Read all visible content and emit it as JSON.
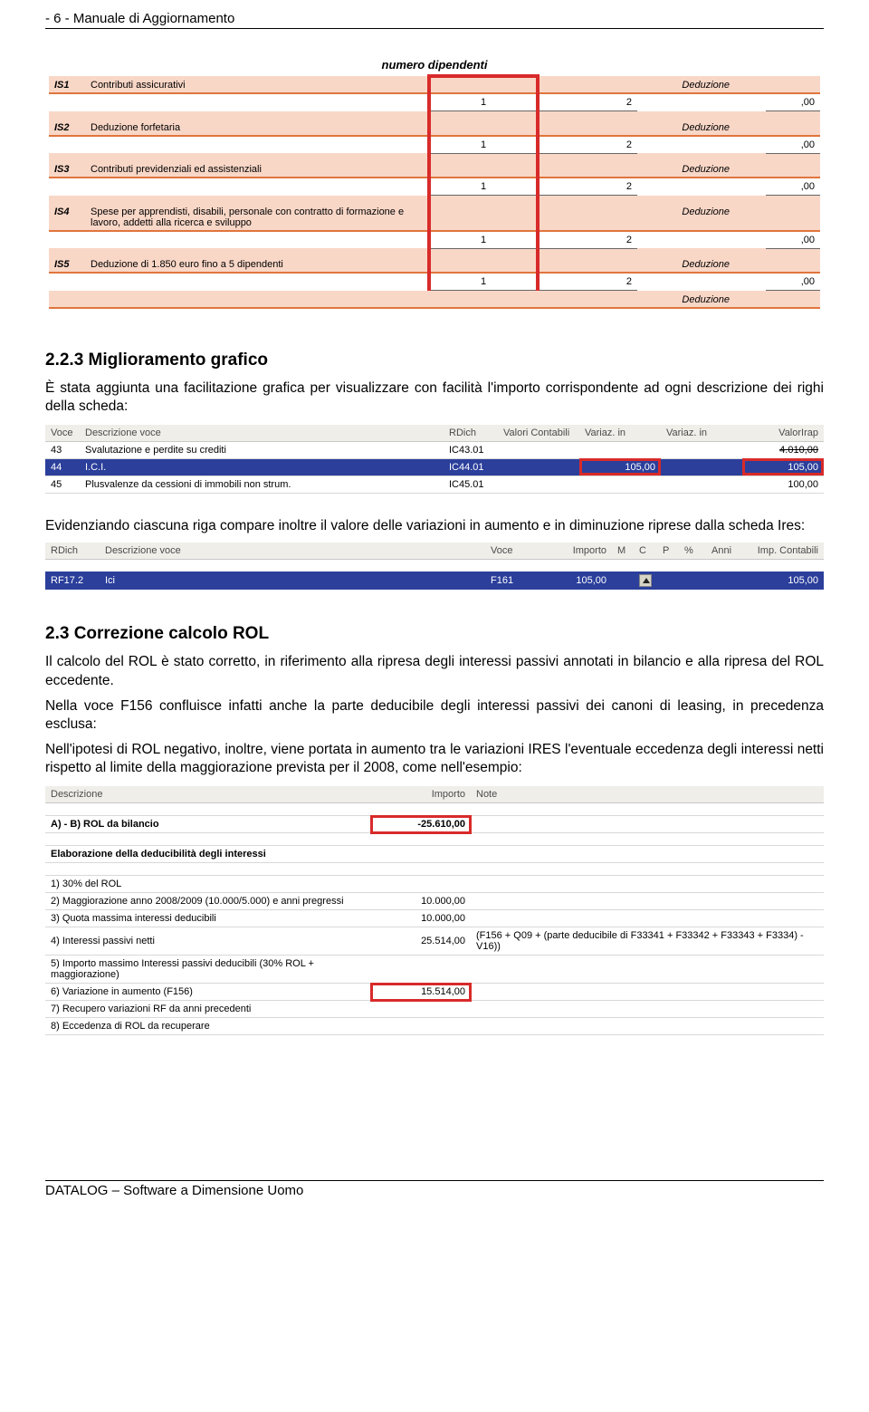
{
  "header": {
    "page_marker": "- 6 -  Manuale di Aggiornamento"
  },
  "footer": {
    "text": "DATALOG – Software a Dimensione Uomo"
  },
  "is_table": {
    "header_label": "numero dipendenti",
    "deduzione_label": "Deduzione",
    "rows": [
      {
        "code": "IS1",
        "desc": "Contributi assicurativi",
        "num": "1",
        "d": "2",
        "val": ",00"
      },
      {
        "code": "IS2",
        "desc": "Deduzione forfetaria",
        "num": "1",
        "d": "2",
        "val": ",00"
      },
      {
        "code": "IS3",
        "desc": "Contributi previdenziali ed assistenziali",
        "num": "1",
        "d": "2",
        "val": ",00"
      },
      {
        "code": "IS4",
        "desc": "Spese per apprendisti, disabili, personale con contratto di formazione e lavoro, addetti alla ricerca e sviluppo",
        "num": "1",
        "d": "2",
        "val": ",00"
      },
      {
        "code": "IS5",
        "desc": "Deduzione di 1.850 euro fino a 5 dipendenti",
        "num": "1",
        "d": "2",
        "val": ",00"
      }
    ],
    "trailing_deduzione": "Deduzione"
  },
  "section_223": {
    "title": "2.2.3  Miglioramento grafico",
    "para": "È stata aggiunta una facilitazione grafica per visualizzare con facilità l'importo corrispondente ad ogni descrizione dei righi della scheda:"
  },
  "var_table": {
    "headers": [
      "Voce",
      "Descrizione voce",
      "RDich",
      "Valori Contabili",
      "Variaz. in",
      "Variaz. in",
      "ValorIrap"
    ],
    "rows": [
      {
        "voce": "43",
        "desc": "Svalutazione e perdite su crediti",
        "rd": "IC43.01",
        "vcont": "",
        "v1": "",
        "v2": "",
        "virap": "4.010,00",
        "sel": false
      },
      {
        "voce": "44",
        "desc": "I.C.I.",
        "rd": "IC44.01",
        "vcont": "",
        "v1": "105,00",
        "v2": "",
        "virap": "105,00",
        "sel": true
      },
      {
        "voce": "45",
        "desc": "Plusvalenze da cessioni di immobili non strum.",
        "rd": "IC45.01",
        "vcont": "",
        "v1": "",
        "v2": "",
        "virap": "100,00",
        "sel": false
      }
    ]
  },
  "para_between": "Evidenziando ciascuna riga compare inoltre il valore delle variazioni in aumento e in diminuzione riprese dalla scheda Ires:",
  "ires_table": {
    "headers": [
      "RDich",
      "Descrizione voce",
      "Voce",
      "Importo",
      "M",
      "C",
      "P",
      "%",
      "Anni",
      "Imp. Contabili"
    ],
    "row": {
      "rd": "RF17.2",
      "desc": "Ici",
      "voce": "F161",
      "imp": "105,00",
      "imp_cont": "105,00"
    }
  },
  "section_23": {
    "title": "2.3  Correzione calcolo ROL",
    "p1": "Il calcolo del ROL è stato corretto, in riferimento alla ripresa degli interessi passivi annotati in bilancio e alla ripresa del ROL eccedente.",
    "p2": "Nella voce F156 confluisce infatti anche la parte deducibile degli interessi passivi dei canoni di leasing, in precedenza esclusa:",
    "p3": "Nell'ipotesi di ROL negativo, inoltre, viene portata in aumento tra le variazioni IRES l'eventuale eccedenza degli interessi netti rispetto al limite della maggiorazione prevista per il 2008, come nell'esempio:"
  },
  "rol_table": {
    "headers": [
      "Descrizione",
      "Importo",
      "Note"
    ],
    "row_ab": {
      "desc": "A) - B) ROL da bilancio",
      "imp": "-25.610,00"
    },
    "row_elab": {
      "desc": "Elaborazione della deducibilità degli interessi"
    },
    "rows": [
      {
        "desc": "1) 30% del ROL",
        "imp": "",
        "note": ""
      },
      {
        "desc": "2) Maggiorazione anno 2008/2009 (10.000/5.000) e anni pregressi",
        "imp": "10.000,00",
        "note": ""
      },
      {
        "desc": "3) Quota massima interessi deducibili",
        "imp": "10.000,00",
        "note": ""
      },
      {
        "desc": "4) Interessi passivi netti",
        "imp": "25.514,00",
        "note": "(F156 + Q09 + (parte deducibile di F33341 + F33342 + F33343 + F3334) - V16))"
      },
      {
        "desc": "5) Importo massimo Interessi passivi deducibili (30% ROL + maggiorazione)",
        "imp": "",
        "note": ""
      },
      {
        "desc": "6) Variazione in aumento (F156)",
        "imp": "15.514,00",
        "note": "",
        "hl": true
      },
      {
        "desc": "7) Recupero variazioni RF da anni precedenti",
        "imp": "",
        "note": ""
      },
      {
        "desc": "8) Eccedenza di ROL da recuperare",
        "imp": "",
        "note": ""
      }
    ]
  }
}
